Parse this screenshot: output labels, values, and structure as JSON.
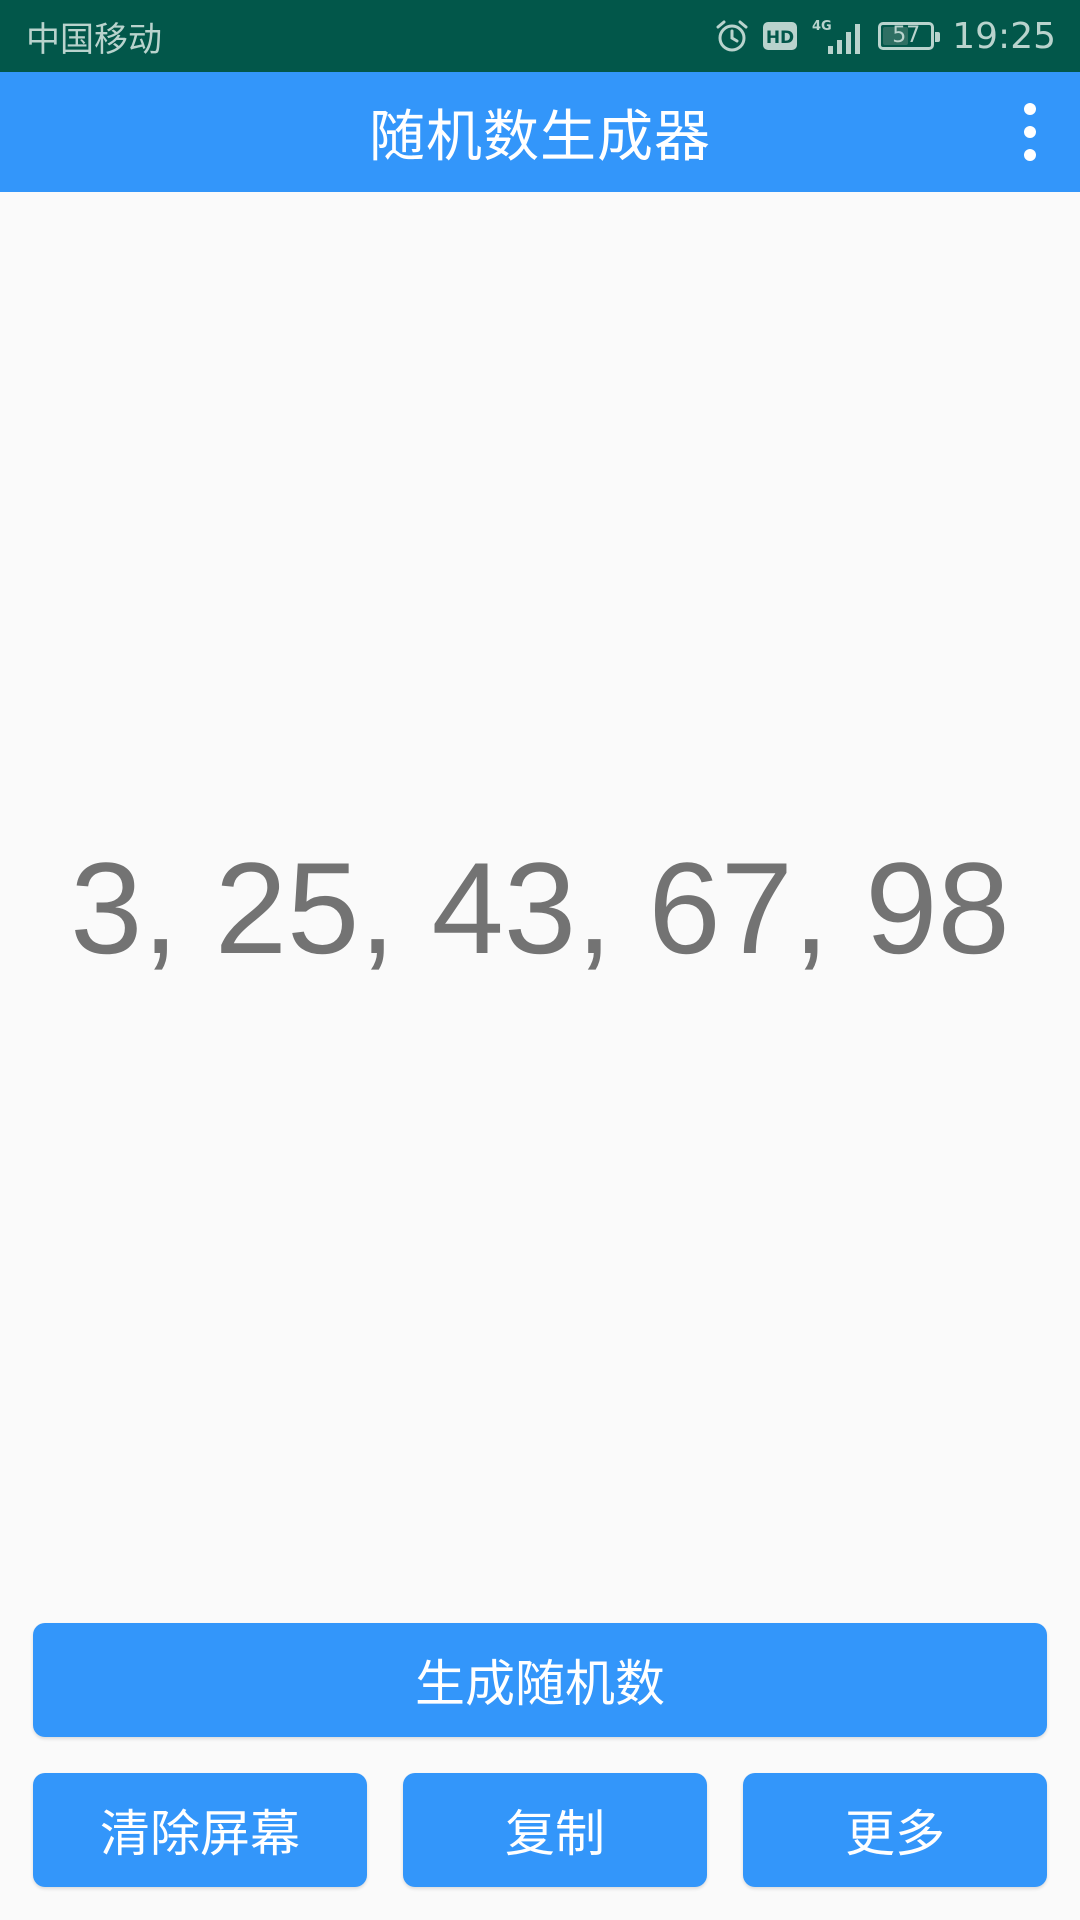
{
  "status_bar": {
    "carrier": "中国移动",
    "network": "4G",
    "hd_label": "HD",
    "battery_level": 57,
    "battery_text": "57",
    "time": "19:25"
  },
  "app_bar": {
    "title": "随机数生成器"
  },
  "result": {
    "text": "3, 25, 43, 67, 98"
  },
  "buttons": {
    "generate": "生成随机数",
    "clear": "清除屏幕",
    "copy": "复制",
    "more": "更多"
  },
  "colors": {
    "status_bar_bg": "#02574a",
    "accent": "#3396fa",
    "result_text": "#737373",
    "background": "#fafafa"
  }
}
